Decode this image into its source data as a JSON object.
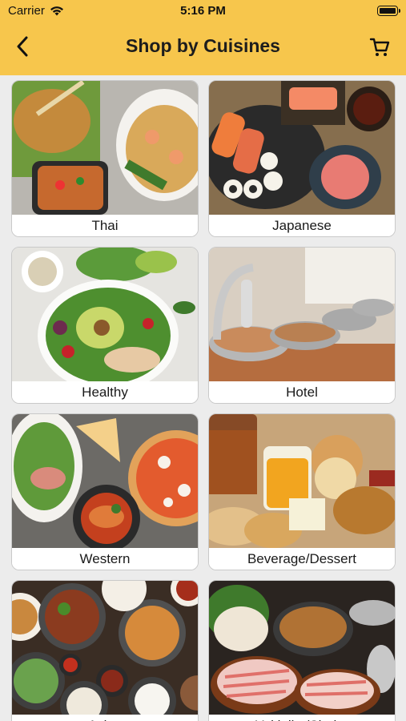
{
  "status_bar": {
    "carrier": "Carrier",
    "time": "5:16 PM"
  },
  "header": {
    "title": "Shop by Cuisines",
    "back_icon": "chevron-left-icon",
    "cart_icon": "cart-icon"
  },
  "colors": {
    "header_bg": "#f7c64c",
    "page_bg": "#ececec",
    "card_bg": "#ffffff"
  },
  "cuisines": [
    {
      "label": "Thai"
    },
    {
      "label": "Japanese"
    },
    {
      "label": "Healthy"
    },
    {
      "label": "Hotel"
    },
    {
      "label": "Western"
    },
    {
      "label": "Beverage/Dessert"
    },
    {
      "label": "Asian"
    },
    {
      "label": "Yakiniku/Shabu"
    }
  ]
}
